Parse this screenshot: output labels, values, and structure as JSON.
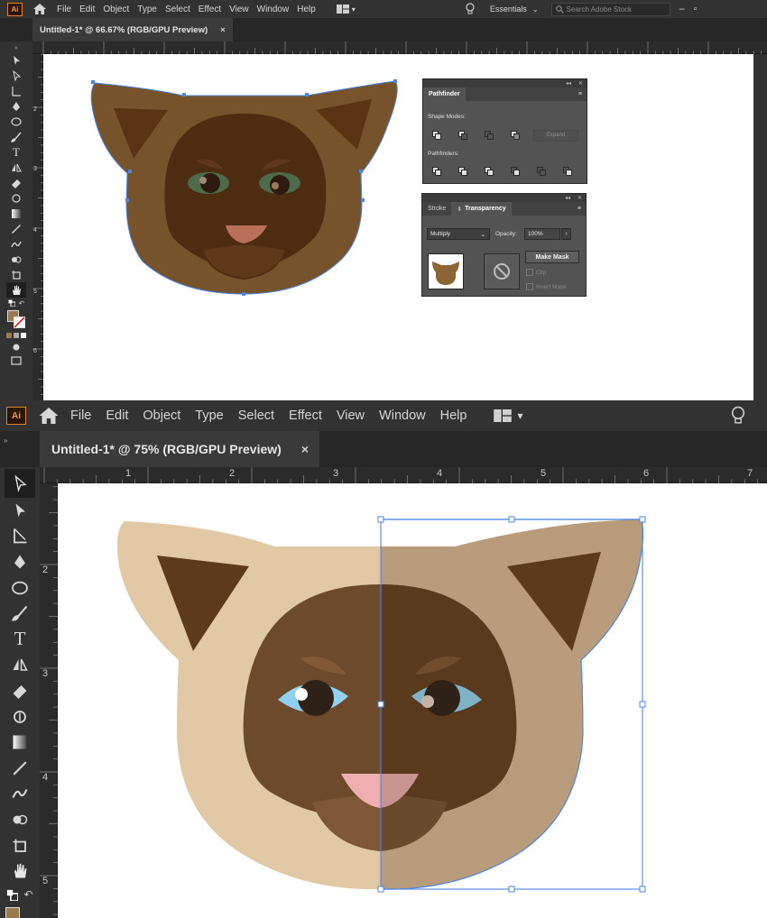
{
  "top": {
    "app_logo": "Ai",
    "menu": [
      "File",
      "Edit",
      "Object",
      "Type",
      "Select",
      "Effect",
      "View",
      "Window",
      "Help"
    ],
    "workspace": "Essentials",
    "search_placeholder": "Search Adobe Stock",
    "doc_tab": "Untitled-1* @ 66.67% (RGB/GPU Preview)",
    "close": "×",
    "ruler_v_labels": [
      "2",
      "3",
      "4",
      "5",
      "6"
    ],
    "pathfinder": {
      "tab": "Pathfinder",
      "shape_modes_label": "Shape Modes:",
      "expand_label": "Expand",
      "pathfinders_label": "Pathfinders:"
    },
    "transparency": {
      "tab_stroke": "Stroke",
      "tab_transparency": "Transparency",
      "blend_mode": "Multiply",
      "opacity_label": "Opacity:",
      "opacity_value": "100%",
      "make_mask": "Make Mask",
      "clip": "Clip",
      "invert_mask": "Invert Mask"
    },
    "cat_colors": {
      "fur": "#76532b",
      "ears": "#5a3314",
      "face": "#4e2c12",
      "eyes": "#4d6b4a",
      "nose": "#b8705a"
    }
  },
  "bottom": {
    "app_logo": "Ai",
    "menu": [
      "File",
      "Edit",
      "Object",
      "Type",
      "Select",
      "Effect",
      "View",
      "Window",
      "Help"
    ],
    "doc_tab": "Untitled-1* @ 75% (RGB/GPU Preview)",
    "close": "×",
    "ruler_h_labels": [
      "1",
      "2",
      "3",
      "4",
      "5",
      "6",
      "7"
    ],
    "ruler_v_labels": [
      "2",
      "3",
      "4",
      "5"
    ],
    "cat_colors": {
      "fur": "#e2c9a6",
      "fur_multiplied": "#b99c7b",
      "ears": "#5c3a1b",
      "face": "#6d4a2c",
      "face_dark": "#593a1d",
      "eyes": "#8fd1ee",
      "eyes_dark": "#7fb2c7",
      "nose": "#f0aeb0"
    }
  },
  "accent": "#4a86e8"
}
